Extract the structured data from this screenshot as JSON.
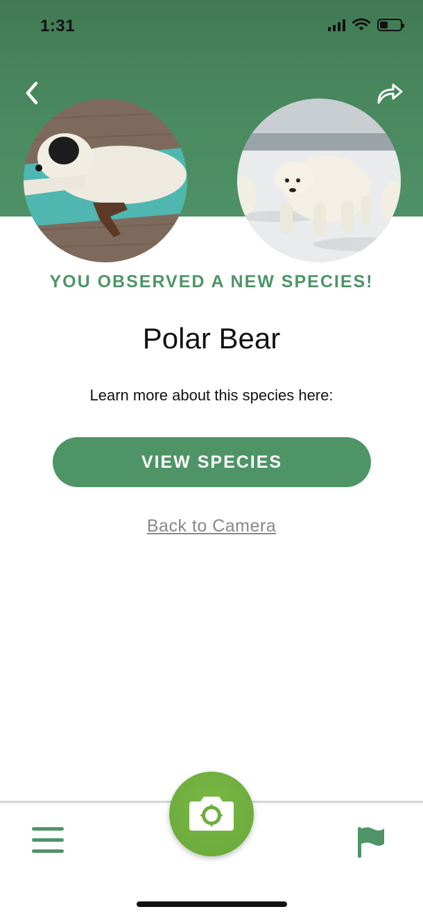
{
  "status_bar": {
    "time": "1:31"
  },
  "header": {
    "back_icon": "chevron-left-icon",
    "share_icon": "share-arrow-icon"
  },
  "photos": {
    "user_photo": "dog on a teal mat",
    "species_photo": "polar bear on snow"
  },
  "result": {
    "headline": "YOU OBSERVED A NEW SPECIES!",
    "species_name": "Polar Bear",
    "learn_more": "Learn more about this species here:",
    "view_button": "VIEW SPECIES",
    "back_link": "Back to Camera"
  },
  "tab_bar": {
    "menu_icon": "hamburger-menu-icon",
    "camera_icon": "camera-icon",
    "flag_icon": "flag-icon"
  },
  "colors": {
    "header_green": "#4a8a5f",
    "accent_green": "#4e9467",
    "camera_green": "#6fae3e"
  }
}
